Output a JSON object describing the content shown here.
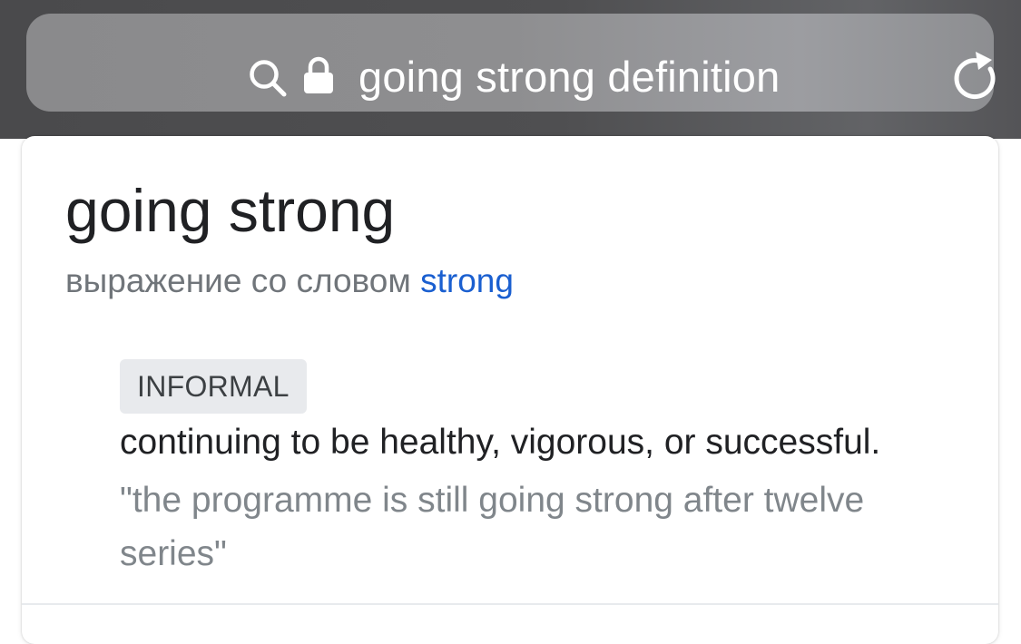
{
  "address_bar": {
    "url_text": "going strong definition",
    "search_icon": "search-icon",
    "lock_icon": "lock-icon",
    "reload_icon": "reload-icon"
  },
  "definition_card": {
    "headword": "going strong",
    "subtitle_prefix": "выражение со словом",
    "subtitle_link": "strong",
    "register_label": "INFORMAL",
    "definition": "continuing to be healthy, vigorous, or successful.",
    "example": "\"the programme is still going strong after twelve series\""
  },
  "colors": {
    "link": "#1a5fd0",
    "text_primary": "#202124",
    "text_secondary": "#70757a",
    "example_text": "#80868b",
    "badge_bg": "#e8eaed",
    "browser_chrome": "#4f4f51"
  }
}
